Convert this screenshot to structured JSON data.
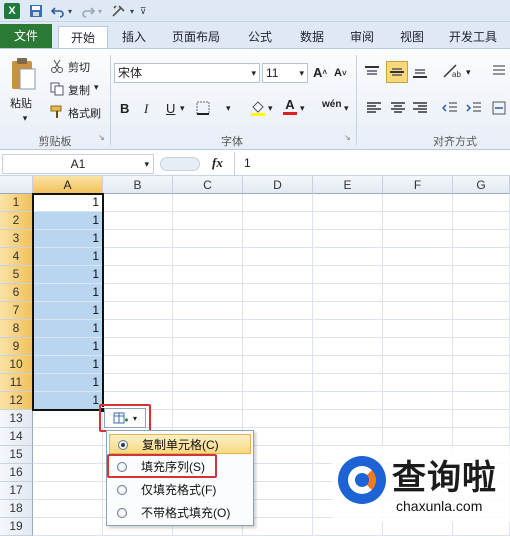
{
  "qat": {
    "excel_icon": "excel-logo-icon"
  },
  "tabs": [
    {
      "label": "文件"
    },
    {
      "label": "开始"
    },
    {
      "label": "插入"
    },
    {
      "label": "页面布局"
    },
    {
      "label": "公式"
    },
    {
      "label": "数据"
    },
    {
      "label": "审阅"
    },
    {
      "label": "视图"
    },
    {
      "label": "开发工具"
    }
  ],
  "ribbon": {
    "paste": "粘贴",
    "cut": "剪切",
    "copy": "复制",
    "format_painter": "格式刷",
    "clipboard_group": "剪贴板",
    "font_name": "宋体",
    "font_size": "11",
    "bold": "B",
    "italic": "I",
    "underline": "U",
    "font_group": "字体",
    "align_group": "对齐方式"
  },
  "formula_bar": {
    "name_box": "A1",
    "fx": "fx",
    "value": "1"
  },
  "columns": [
    "A",
    "B",
    "C",
    "D",
    "E",
    "F",
    "G"
  ],
  "rows": [
    "1",
    "2",
    "3",
    "4",
    "5",
    "6",
    "7",
    "8",
    "9",
    "10",
    "11",
    "12",
    "13",
    "14",
    "15",
    "16",
    "17",
    "18",
    "19"
  ],
  "cells_a": [
    "1",
    "1",
    "1",
    "1",
    "1",
    "1",
    "1",
    "1",
    "1",
    "1",
    "1",
    "1"
  ],
  "autofill_menu": {
    "items": [
      {
        "label": "复制单元格(C)",
        "selected": true
      },
      {
        "label": "填充序列(S)",
        "selected": false
      },
      {
        "label": "仅填充格式(F)",
        "selected": false
      },
      {
        "label": "不带格式填充(O)",
        "selected": false
      }
    ]
  },
  "watermark": {
    "text": "查询啦",
    "url": "chaxunla.com"
  },
  "colors": {
    "selection_fill": "#b9d6f0",
    "file_tab": "#2a7a35",
    "highlight_box": "#d2343a",
    "header_selected": "#f1c15b"
  }
}
